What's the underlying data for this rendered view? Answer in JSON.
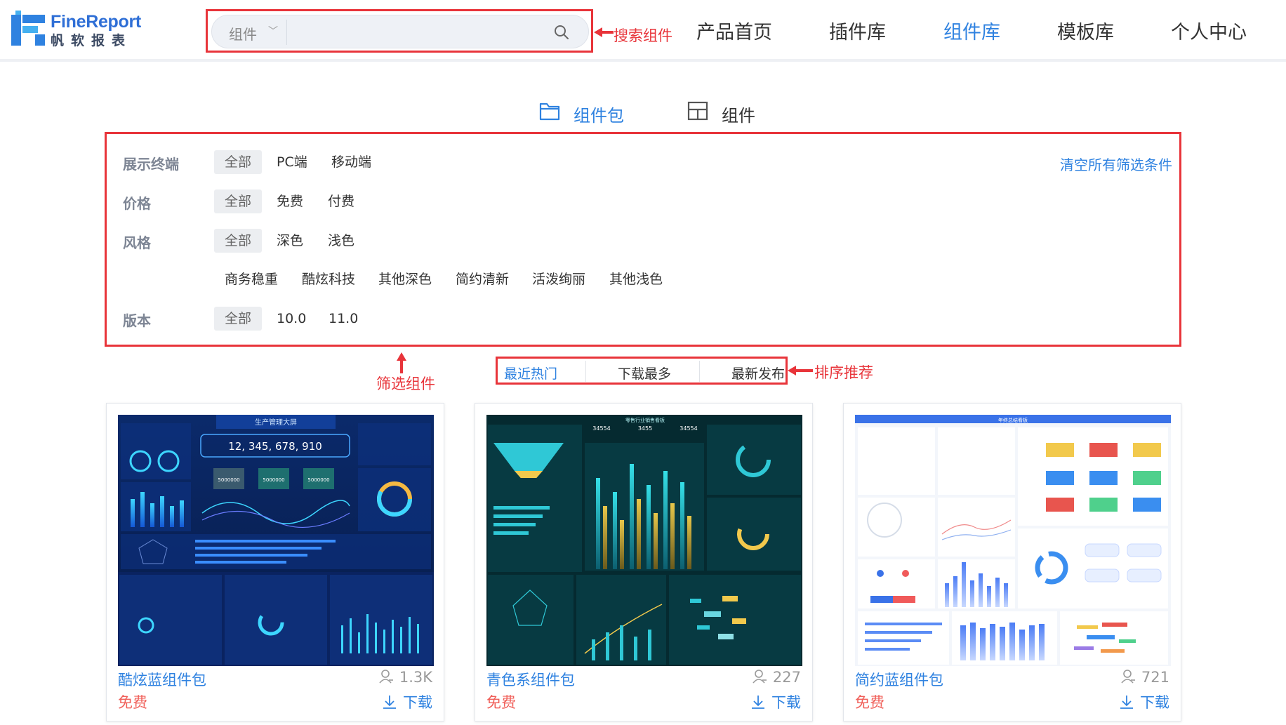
{
  "header": {
    "logo": {
      "en": "FineReport",
      "cn": "帆软报表"
    },
    "search": {
      "category": "组件",
      "placeholder": ""
    },
    "nav": [
      "产品首页",
      "插件库",
      "组件库",
      "模板库",
      "个人中心"
    ],
    "active_nav": "组件库"
  },
  "annotations": {
    "search": "搜索组件",
    "filter": "筛选组件",
    "sort": "排序推荐"
  },
  "tabs": [
    {
      "label": "组件包",
      "icon": "folder-icon",
      "active": true
    },
    {
      "label": "组件",
      "icon": "layout-icon",
      "active": false
    }
  ],
  "filters": {
    "clear_label": "清空所有筛选条件",
    "groups": [
      {
        "label": "展示终端",
        "options": [
          "全部",
          "PC端",
          "移动端"
        ],
        "selected": "全部"
      },
      {
        "label": "价格",
        "options": [
          "全部",
          "免费",
          "付费"
        ],
        "selected": "全部"
      },
      {
        "label": "风格",
        "options": [
          "全部",
          "深色",
          "浅色"
        ],
        "selected": "全部",
        "sub_options": [
          "商务稳重",
          "酷炫科技",
          "其他深色",
          "简约清新",
          "活泼绚丽",
          "其他浅色"
        ]
      },
      {
        "label": "版本",
        "options": [
          "全部",
          "10.0",
          "11.0"
        ],
        "selected": "全部"
      }
    ]
  },
  "sort": {
    "options": [
      "最近热门",
      "下载最多",
      "最新发布"
    ],
    "active": "最近热门"
  },
  "cards": [
    {
      "title": "酷炫蓝组件包",
      "price": "免费",
      "count": "1.3K",
      "download": "下载",
      "thumb": {
        "heading": "生产管理大屏",
        "big_number": "12, 345, 678, 910",
        "kpis": [
          "5000000",
          "5000000",
          "5000000"
        ]
      }
    },
    {
      "title": "青色系组件包",
      "price": "免费",
      "count": "227",
      "download": "下载",
      "thumb": {
        "heading": "零售行业销售看板",
        "kpis": [
          "34554",
          "3455",
          "34554"
        ]
      }
    },
    {
      "title": "简约蓝组件包",
      "price": "免费",
      "count": "721",
      "download": "下载",
      "thumb": {
        "heading": "年终总结看板"
      }
    }
  ],
  "colors": {
    "accent": "#2f82e0",
    "annotation": "#e8343a",
    "price": "#f0605a"
  }
}
